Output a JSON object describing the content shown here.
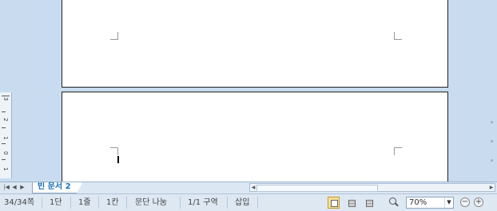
{
  "tabs": {
    "document": "빈 문서 2"
  },
  "ruler": {
    "numbers": [
      "3",
      "2",
      "1",
      "0",
      "1"
    ]
  },
  "status": {
    "page": "34/34쪽",
    "column": "1단",
    "line": "1줄",
    "char_col": "1칸",
    "paragraph_break": "문단 나눔",
    "section": "1/1 구역",
    "insert_mode": "삽입"
  },
  "zoom": {
    "value": "70%"
  },
  "icons": {
    "zoom": "magnifier-icon",
    "zoom_out": "minus-circle-icon",
    "zoom_in": "plus-circle-icon",
    "dropdown": "chevron-down-icon"
  },
  "colors": {
    "workspace": "#c9dcef",
    "tab_text": "#1a6fb5",
    "active_view": "#f7e19a"
  }
}
